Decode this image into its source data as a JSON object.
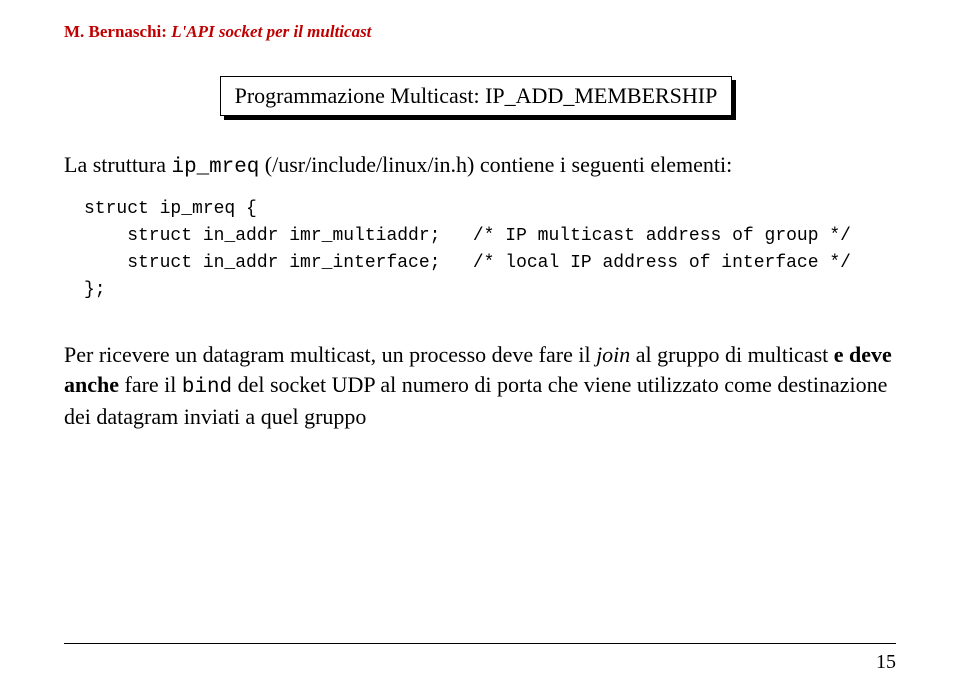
{
  "header": {
    "author": "M. Bernaschi:",
    "title_italic": "L'API socket per il multicast"
  },
  "title_box": "Programmazione Multicast: IP_ADD_MEMBERSHIP",
  "intro": {
    "part1": "La struttura ",
    "code1": "ip_mreq",
    "part2": " (/usr/include/linux/in.h) contiene i seguenti elementi:"
  },
  "code": "struct ip_mreq {\n    struct in_addr imr_multiaddr;   /* IP multicast address of group */\n    struct in_addr imr_interface;   /* local IP address of interface */\n};",
  "body": {
    "t1": "Per ricevere un datagram multicast, un processo deve fare il ",
    "join": "join",
    "t2": " al gruppo di multicast ",
    "bold": "e deve anche",
    "t3": " fare il ",
    "bind": "bind",
    "t4": " del socket UDP al numero di porta che viene utilizzato come destinazione dei datagram inviati a quel gruppo"
  },
  "page_number": "15"
}
